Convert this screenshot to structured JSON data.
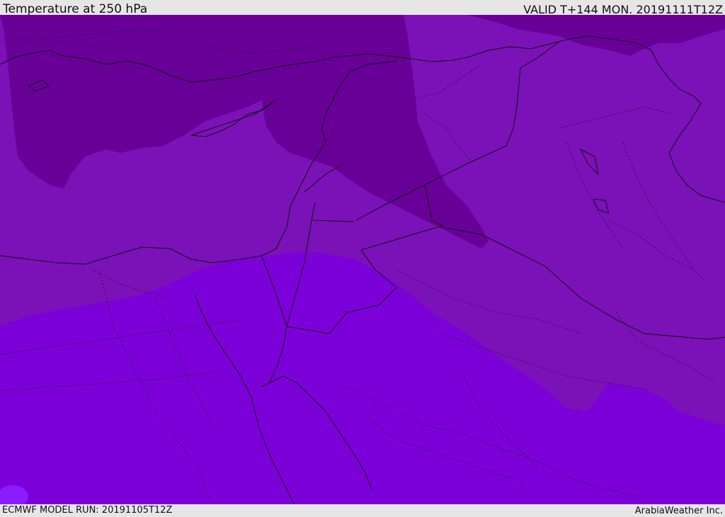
{
  "header": {
    "title": "Temperature at 250 hPa",
    "valid": "VALID T+144 MON. 20191111T12Z"
  },
  "footer": {
    "model_run": "ECMWF MODEL RUN: 20191105T12Z",
    "credit": "ArabiaWeather Inc."
  },
  "map": {
    "colors": {
      "coldest": "#680098",
      "cold": "#7a12b8",
      "mid": "#7c00d8",
      "warm_spot": "#8a1cff",
      "borders": "#111111"
    }
  }
}
